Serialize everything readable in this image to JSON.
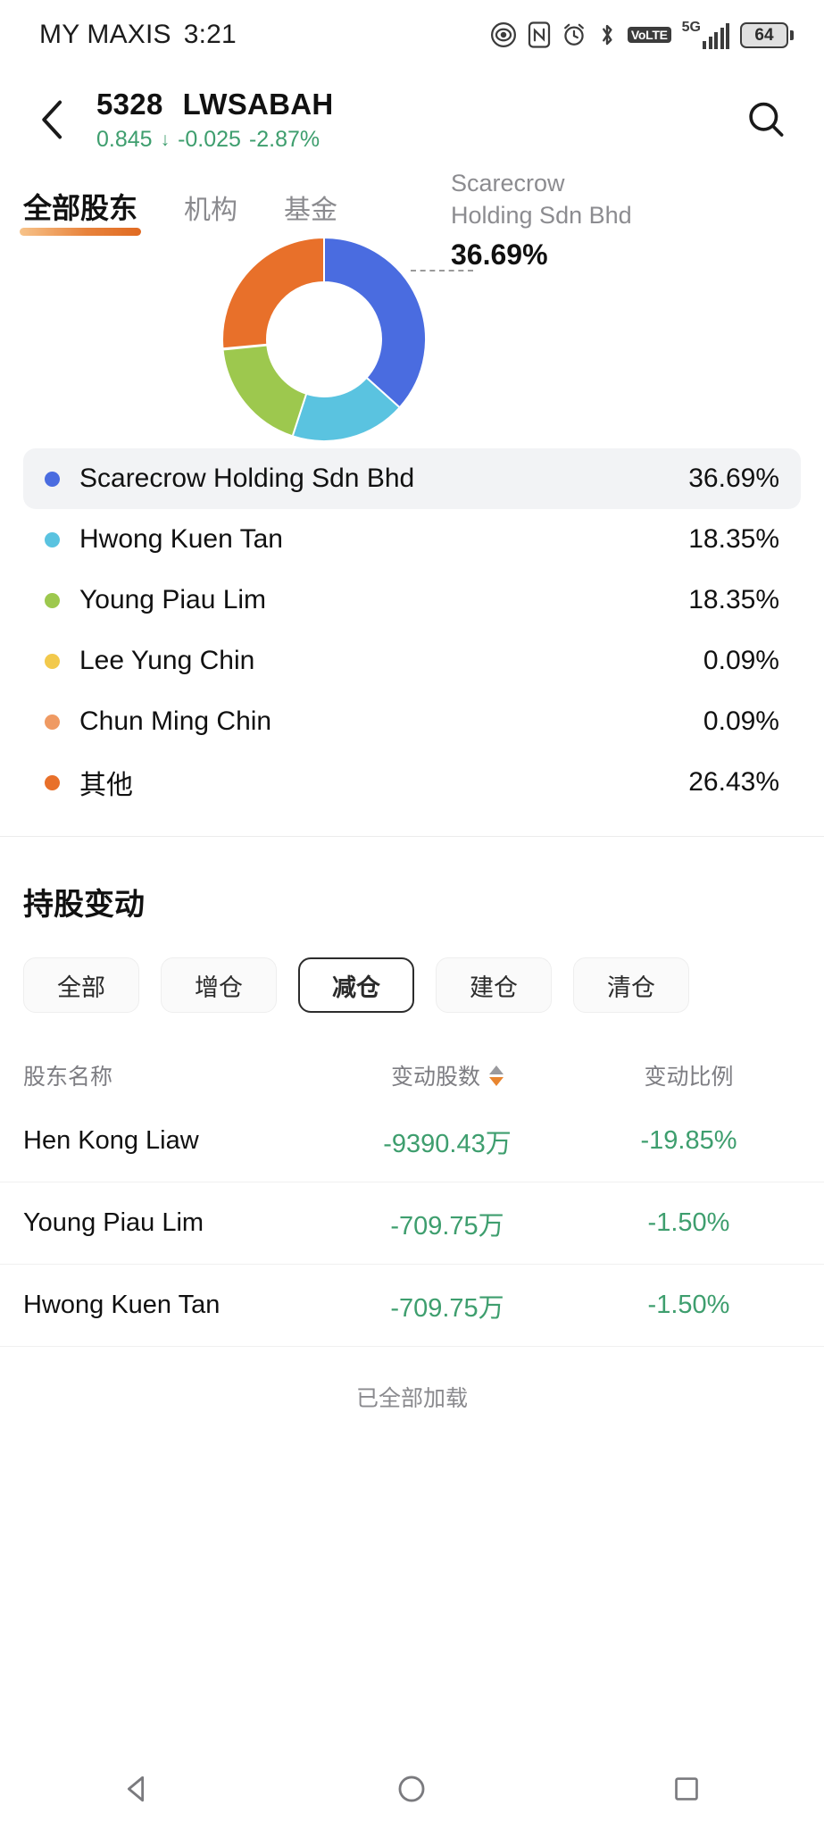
{
  "statusbar": {
    "carrier": "MY MAXIS",
    "time": "3:21",
    "volte_label": "VoLTE",
    "network_label": "5G",
    "battery_level": "64",
    "icons": [
      "eye-icon",
      "nfc-icon",
      "alarm-icon",
      "bluetooth-icon",
      "volte-icon",
      "signal-icon",
      "battery-icon"
    ]
  },
  "header": {
    "back_icon": "chevron-left-icon",
    "stock_code": "5328",
    "stock_name": "LWSABAH",
    "last_price": "0.845",
    "arrow": "↓",
    "change": "-0.025",
    "change_pct": "-2.87%",
    "price_color": "#3e9e6e",
    "search_icon": "search-icon"
  },
  "tabs": [
    {
      "label": "全部股东",
      "active": true
    },
    {
      "label": "机构",
      "active": false
    },
    {
      "label": "基金",
      "active": false
    }
  ],
  "callout": {
    "line1": "Scarecrow",
    "line2": "Holding Sdn Bhd",
    "percent": "36.69%"
  },
  "chart_data": {
    "type": "pie",
    "title": "",
    "legend_position": "below",
    "categories": [
      "Scarecrow Holding Sdn Bhd",
      "Hwong Kuen Tan",
      "Young Piau Lim",
      "Lee Yung Chin",
      "Chun Ming Chin",
      "其他"
    ],
    "values": [
      36.69,
      18.35,
      18.35,
      0.09,
      0.09,
      26.43
    ],
    "value_labels": [
      "36.69%",
      "18.35%",
      "18.35%",
      "0.09%",
      "0.09%",
      "26.43%"
    ],
    "colors": [
      "#4a6ce0",
      "#5ac3e0",
      "#9dc84e",
      "#f2c94c",
      "#ef9a63",
      "#e8702a"
    ],
    "donut": true,
    "inner_radius_ratio": 0.56
  },
  "legend": [
    {
      "name": "Scarecrow Holding Sdn Bhd",
      "value": "36.69%",
      "color": "#4a6ce0",
      "highlighted": true
    },
    {
      "name": "Hwong Kuen Tan",
      "value": "18.35%",
      "color": "#5ac3e0",
      "highlighted": false
    },
    {
      "name": "Young Piau Lim",
      "value": "18.35%",
      "color": "#9dc84e",
      "highlighted": false
    },
    {
      "name": "Lee Yung Chin",
      "value": "0.09%",
      "color": "#f2c94c",
      "highlighted": false
    },
    {
      "name": "Chun Ming Chin",
      "value": "0.09%",
      "color": "#ef9a63",
      "highlighted": false
    },
    {
      "name": "其他",
      "value": "26.43%",
      "color": "#e8702a",
      "highlighted": false
    }
  ],
  "holdings": {
    "section_title": "持股变动",
    "chips": [
      {
        "label": "全部",
        "selected": false
      },
      {
        "label": "增仓",
        "selected": false
      },
      {
        "label": "减仓",
        "selected": true
      },
      {
        "label": "建仓",
        "selected": false
      },
      {
        "label": "清仓",
        "selected": false
      }
    ],
    "columns": [
      "股东名称",
      "变动股数",
      "变动比例"
    ],
    "sort_column": "变动股数",
    "sort_direction": "desc",
    "rows": [
      {
        "name": "Hen Kong Liaw",
        "shares": "-9390.43万",
        "pct": "-19.85%"
      },
      {
        "name": "Young Piau Lim",
        "shares": "-709.75万",
        "pct": "-1.50%"
      },
      {
        "name": "Hwong Kuen Tan",
        "shares": "-709.75万",
        "pct": "-1.50%"
      }
    ],
    "footer": "已全部加载"
  },
  "navbar": {
    "back": "back-triangle-icon",
    "home": "home-circle-icon",
    "recents": "recents-square-icon"
  }
}
